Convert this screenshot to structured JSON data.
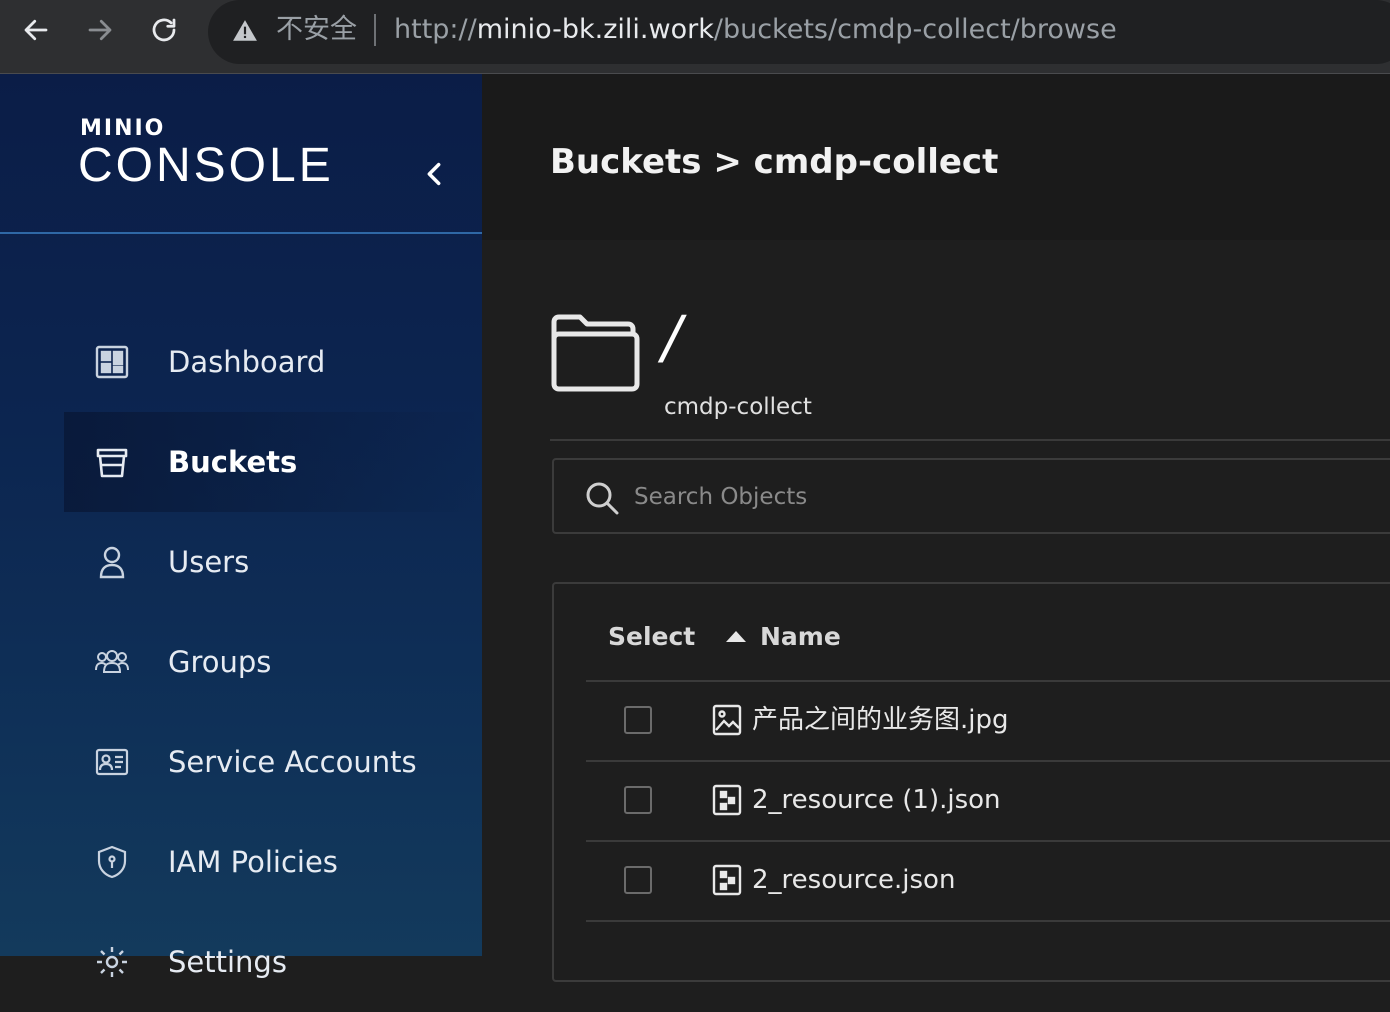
{
  "browser": {
    "security_label": "不安全",
    "url_scheme": "http://",
    "url_host": "minio-bk.zili.work",
    "url_path": "/buckets/cmdp-collect/browse"
  },
  "sidebar": {
    "logo_top": "MINIO",
    "logo_bottom": "CONSOLE",
    "items": [
      {
        "label": "Dashboard",
        "icon": "dashboard-icon",
        "active": false
      },
      {
        "label": "Buckets",
        "icon": "bucket-icon",
        "active": true
      },
      {
        "label": "Users",
        "icon": "user-icon",
        "active": false
      },
      {
        "label": "Groups",
        "icon": "groups-icon",
        "active": false
      },
      {
        "label": "Service Accounts",
        "icon": "service-accounts-icon",
        "active": false
      },
      {
        "label": "IAM Policies",
        "icon": "shield-icon",
        "active": false
      },
      {
        "label": "Settings",
        "icon": "gear-icon",
        "active": false
      }
    ]
  },
  "main": {
    "breadcrumb": "Buckets > cmdp-collect",
    "path": "/",
    "bucket_name": "cmdp-collect",
    "search_placeholder": "Search Objects",
    "table": {
      "col_select": "Select",
      "col_name": "Name",
      "sort": "ascending",
      "rows": [
        {
          "name": "产品之间的业务图.jpg",
          "icon": "image-file-icon",
          "checked": false
        },
        {
          "name": "2_resource (1).json",
          "icon": "file-icon",
          "checked": false
        },
        {
          "name": "2_resource.json",
          "icon": "file-icon",
          "checked": false
        }
      ]
    }
  },
  "colors": {
    "sidebar_top": "#0b1d47",
    "sidebar_bottom": "#133a5c",
    "main_bg": "#1e1e1e",
    "accent_line": "#2f68a6"
  }
}
